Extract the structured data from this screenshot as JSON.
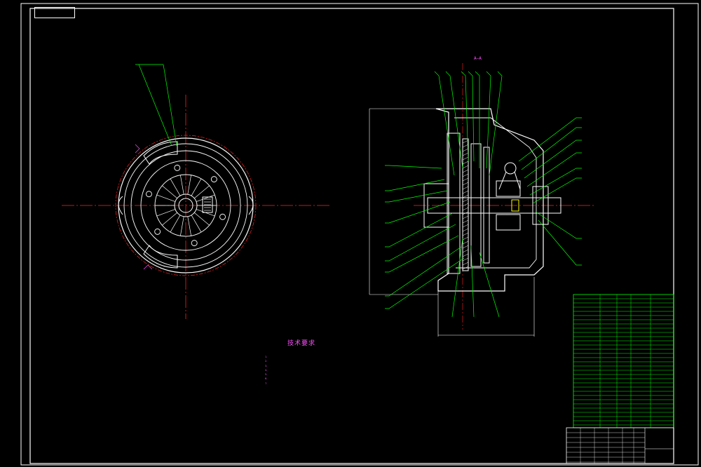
{
  "drawing_number_stamp": "",
  "section_label": "A—A",
  "technical_requirements": {
    "title": "技术要求",
    "notes": [
      "1.",
      "2.",
      "3.",
      "4.",
      "5.",
      "6.",
      "7."
    ]
  },
  "title_block": {
    "title": "",
    "drawing_code": ""
  },
  "colors": {
    "background": "#000000",
    "frame": "#ffffff",
    "outline": "#ffffff",
    "leader": "#00ff00",
    "centerline": "#ff2020",
    "annotation": "#ff4fff",
    "table_line": "#00ff00"
  }
}
